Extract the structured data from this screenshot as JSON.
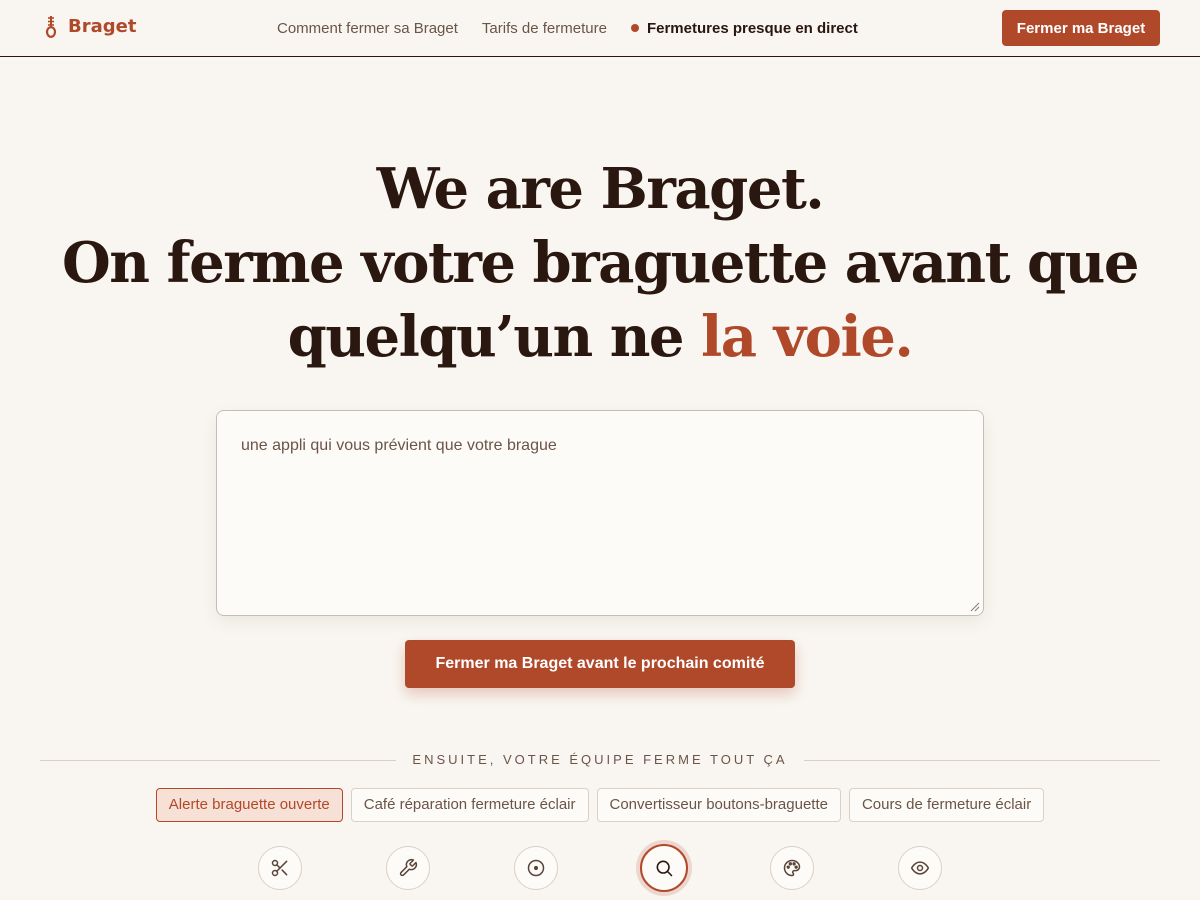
{
  "header": {
    "brand": "Braget",
    "nav": [
      "Comment fermer sa Braget",
      "Tarifs de fermeture"
    ],
    "live_label": "Fermetures presque en direct",
    "cta_label": "Fermer ma Braget"
  },
  "hero": {
    "line1": "We are Braget.",
    "line2": "On ferme votre braguette avant que",
    "line3_plain": "quelqu’un ne ",
    "line3_accent": "la voie."
  },
  "prompt": {
    "placeholder": "une appli qui vous prévient que votre brague"
  },
  "submit_label": "Fermer ma Braget avant le prochain comité",
  "section_label": "ENSUITE, VOTRE ÉQUIPE FERME TOUT ÇA",
  "chips": [
    {
      "label": "Alerte braguette ouverte",
      "active": true
    },
    {
      "label": "Café réparation fermeture éclair",
      "active": false
    },
    {
      "label": "Convertisseur boutons-braguette",
      "active": false
    },
    {
      "label": "Cours de fermeture éclair",
      "active": false
    }
  ],
  "tools": [
    {
      "icon": "scissors-icon",
      "label": "",
      "active": false
    },
    {
      "icon": "wrench-icon",
      "label": "",
      "active": false
    },
    {
      "icon": "button-icon",
      "label": "",
      "active": false
    },
    {
      "icon": "search-icon",
      "label": "",
      "active": true
    },
    {
      "icon": "palette-icon",
      "label": "",
      "active": false
    },
    {
      "icon": "eye-icon",
      "label": "",
      "active": false
    }
  ],
  "colors": {
    "accent": "#b0492a",
    "background": "#f9f6f1",
    "text": "#2a1710",
    "muted": "#6b5448"
  }
}
